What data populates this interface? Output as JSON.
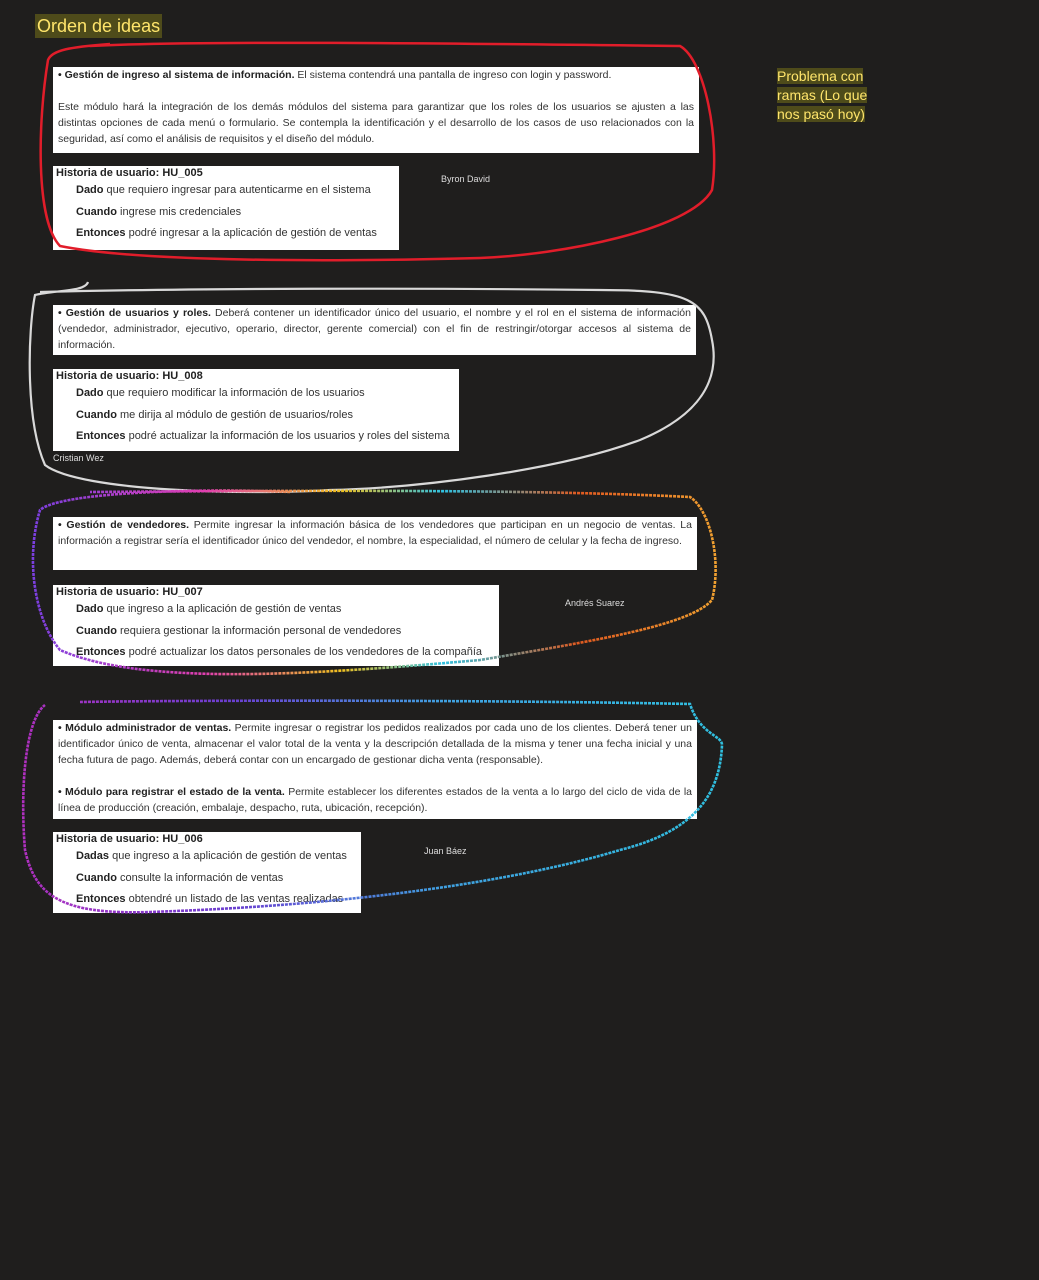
{
  "title": "Orden de ideas",
  "side_note": "Problema con ramas (Lo que nos pasó hoy)",
  "sections": [
    {
      "heading": "• Gestión de ingreso al sistema de información.",
      "text": " El sistema contendrá una pantalla de ingreso con login y password.",
      "text2": "Este módulo hará la integración de los demás módulos del sistema para garantizar que los roles de los usuarios se ajusten a las distintas opciones de cada menú o formulario. Se contempla la identificación y el desarrollo de los casos de uso relacionados con la seguridad, así como el análisis de requisitos y el diseño del módulo.",
      "story_id": "Historia de usuario: HU_005",
      "given_kw": "Dado",
      "given": " que requiero ingresar para autenticarme en el sistema",
      "when_kw": "Cuando",
      "when": " ingrese mis credenciales",
      "then_kw": "Entonces",
      "then": " podré ingresar a la aplicación de gestión de ventas",
      "author": "Byron David",
      "circle_color": "#e11d2a"
    },
    {
      "heading": "• Gestión de usuarios y roles.",
      "text": " Deberá contener un identificador único del usuario, el nombre y el rol en el sistema de información (vendedor, administrador, ejecutivo, operario, director, gerente comercial) con el fin de restringir/otorgar accesos al sistema de información.",
      "story_id": "Historia de usuario: HU_008",
      "given_kw": "Dado",
      "given": " que requiero modificar la información de los usuarios",
      "when_kw": "Cuando",
      "when": " me dirija al módulo de gestión de usuarios/roles",
      "then_kw": "Entonces",
      "then": " podré actualizar la información de los usuarios y roles del sistema",
      "author": "Cristian Wez",
      "circle_color": "#d9d9d9"
    },
    {
      "heading": "• Gestión de vendedores.",
      "text": " Permite ingresar la información básica de los vendedores que participan en un negocio de ventas. La información a registrar sería el identificador único del vendedor, el nombre, la especialidad, el número de celular y la fecha de ingreso.",
      "story_id": "Historia de usuario: HU_007",
      "given_kw": "Dado",
      "given": " que ingreso a la aplicación de gestión de ventas",
      "when_kw": "Cuando",
      "when": " requiera gestionar la información personal de vendedores",
      "then_kw": "Entonces",
      "then": " podré actualizar los datos personales de los vendedores de la compañía",
      "author": "Andrés Suarez",
      "circle_color": "rainbow"
    },
    {
      "heading": "• Módulo administrador de ventas.",
      "text": " Permite ingresar o registrar los pedidos realizados por cada uno de los clientes. Deberá tener un identificador único de venta, almacenar el valor total de la venta y la descripción detallada de la misma y tener una fecha inicial y una fecha futura de pago. Además, deberá contar con un encargado de gestionar dicha venta (responsable).",
      "heading2": "• Módulo para registrar el estado de la venta.",
      "text2": " Permite establecer los diferentes estados de la venta a lo largo del ciclo de vida de la línea de producción (creación, embalaje, despacho, ruta, ubicación, recepción).",
      "story_id": "Historia de usuario: HU_006",
      "given_kw": "Dadas",
      "given": " que ingreso a la aplicación de gestión de ventas",
      "when_kw": "Cuando",
      "when": " consulte la información de ventas",
      "then_kw": "Entonces",
      "then": " obtendré un listado de las ventas realizadas",
      "author": "Juan Báez",
      "circle_color": "rainbow-purple"
    }
  ]
}
